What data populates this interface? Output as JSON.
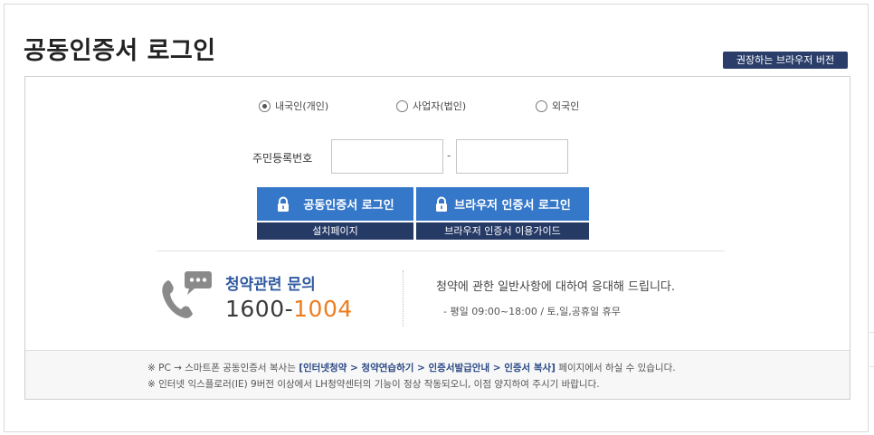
{
  "page": {
    "title": "공동인증서 로그인"
  },
  "header": {
    "browser_version_button": "권장하는 브라우저 버전"
  },
  "radios": [
    {
      "label": "내국인(개인)",
      "checked": true
    },
    {
      "label": "사업자(법인)",
      "checked": false
    },
    {
      "label": "외국인",
      "checked": false
    }
  ],
  "id_field": {
    "label": "주민등록번호",
    "part1_value": "",
    "part2_value": "",
    "separator": "-"
  },
  "buttons": {
    "cert_login": "공동인증서 로그인",
    "browser_login": "브라우저 인증서 로그인",
    "install_page": "설치페이지",
    "browser_guide": "브라우저 인증서 이용가이드"
  },
  "inquiry": {
    "title": "청약관련 문의",
    "number_prefix": "1600-",
    "number_suffix": "1004",
    "description": "청약에 관한 일반사항에 대하여 응대해 드립니다.",
    "hours": "- 평일 09:00~18:00  /  토,일,공휴일 휴무"
  },
  "notice": {
    "line1_prefix": "※ PC → 스마트폰 공동인증서 복사는 ",
    "line1_bold": "[인터넷청약 > 청약연습하기 > 인증서발급안내 > 인증서 복사]",
    "line1_suffix": " 페이지에서 하실 수 있습니다.",
    "line2": "※ 인터넷 익스플로러(IE) 9버전 이상에서 LH청약센터의 기능이 정상 작동되오니, 이점 양지하여 주시기 바랍니다."
  },
  "colors": {
    "primary_blue": "#3578c9",
    "dark_navy": "#263a66",
    "inquiry_blue": "#2f5aa0",
    "accent_orange": "#ee7d1e"
  },
  "icons": {
    "lock": "lock-icon",
    "phone": "phone-chat-icon"
  }
}
